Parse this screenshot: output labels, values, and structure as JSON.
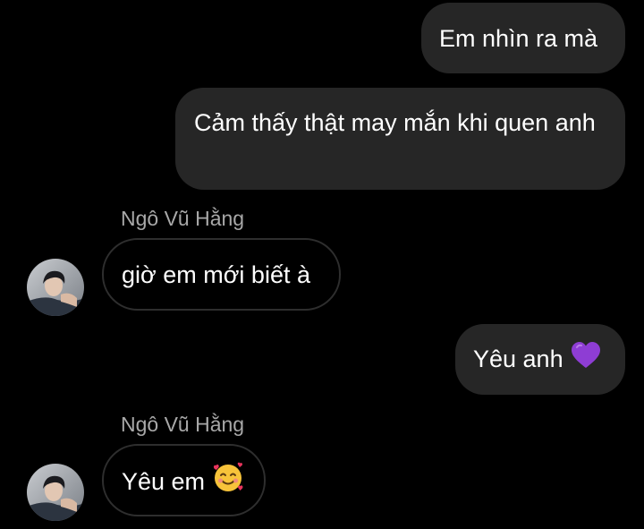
{
  "messages": [
    {
      "direction": "outgoing",
      "text": "Em nhìn ra mà"
    },
    {
      "direction": "outgoing",
      "text": "Cảm thấy thật may mắn khi quen anh"
    },
    {
      "direction": "incoming",
      "sender": "Ngô Vũ Hằng",
      "text": "giờ em mới biết à"
    },
    {
      "direction": "outgoing",
      "text": "Yêu anh",
      "emoji": "purple-heart"
    },
    {
      "direction": "incoming",
      "sender": "Ngô Vũ Hằng",
      "text": "Yêu em",
      "emoji": "smiling-face-with-hearts"
    }
  ],
  "colors": {
    "background": "#000000",
    "outgoing_bubble": "#262626",
    "incoming_border": "#2e2e2e",
    "sender_name": "#a8a8a8",
    "text": "#ffffff",
    "purple_heart": "#8e3dd4"
  }
}
